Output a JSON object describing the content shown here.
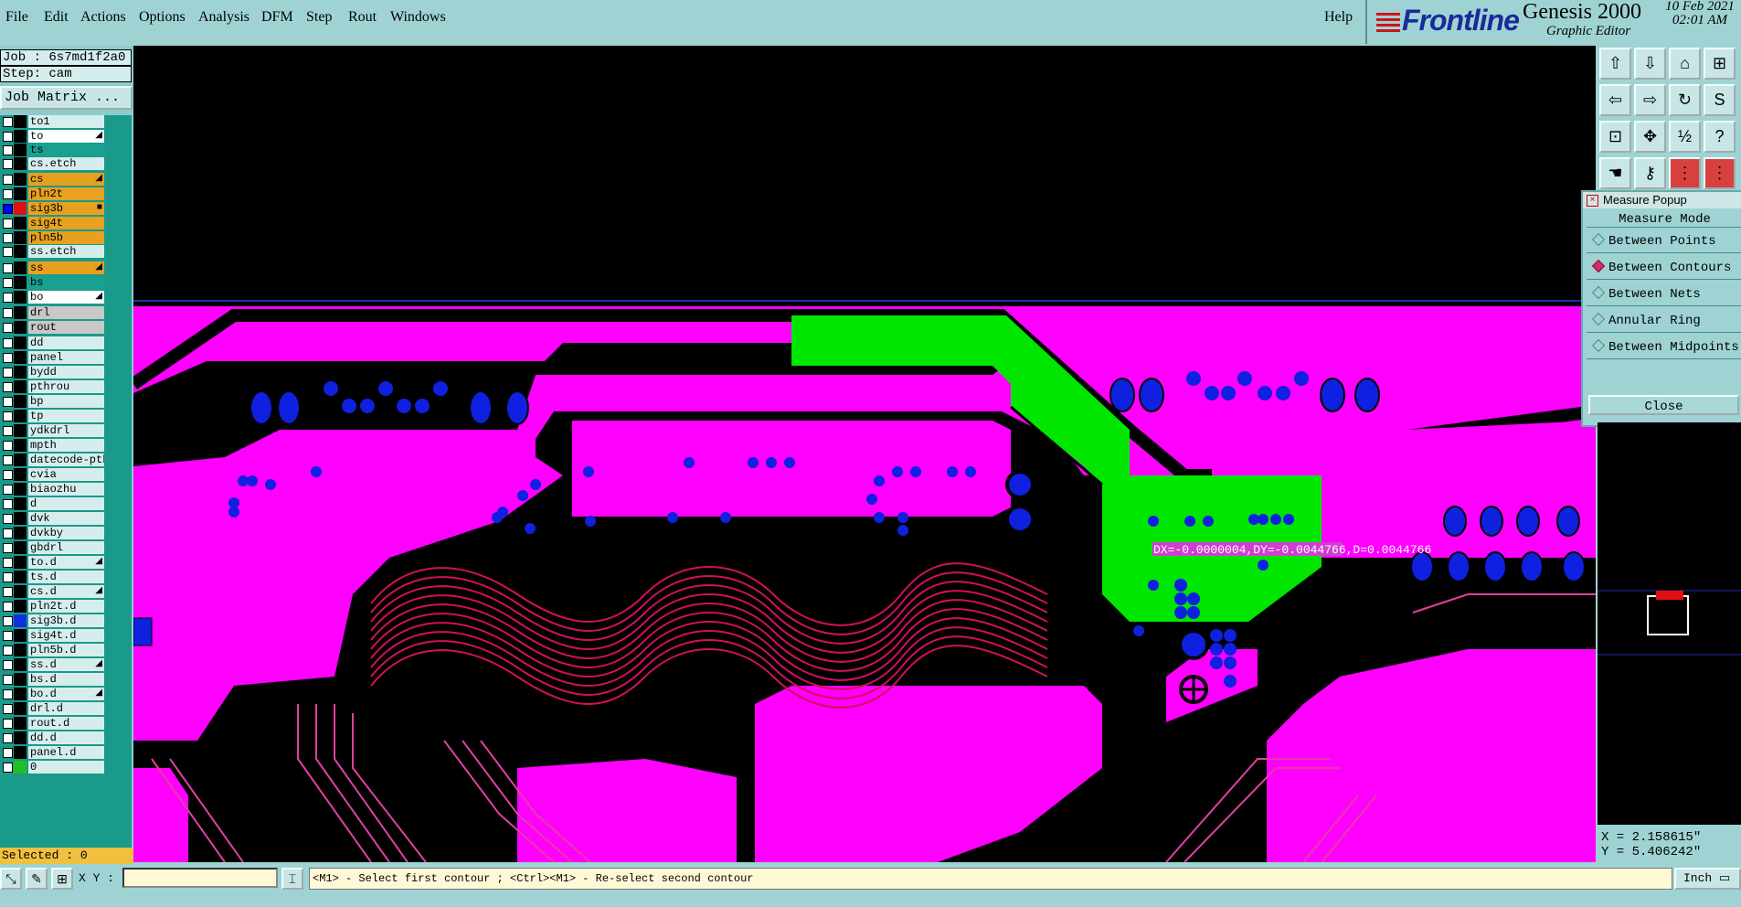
{
  "menu": {
    "items": [
      "File",
      "Edit",
      "Actions",
      "Options",
      "Analysis",
      "DFM",
      "Step",
      "Rout",
      "Windows"
    ],
    "help": "Help"
  },
  "brand": {
    "logo": "Frontline",
    "product": "Genesis 2000",
    "subtitle": "Graphic Editor",
    "date": "10 Feb 2021",
    "time": "02:01 AM"
  },
  "job": {
    "job_line": "Job : 6s7md1f2a0",
    "step_line": "Step: cam",
    "matrix_button": "Job Matrix ..."
  },
  "layers": [
    {
      "name": "to1",
      "bg": "#d6eded",
      "sw": "#000000"
    },
    {
      "name": "to",
      "bg": "#ffffff",
      "sw": "#000000",
      "mark": "◢"
    },
    {
      "name": "ts",
      "bg": "#1aa090",
      "sw": "#000000"
    },
    {
      "name": "cs.etch",
      "bg": "#d6eded",
      "sw": "#000000"
    },
    {
      "name": "cs",
      "bg": "#e8a020",
      "sw": "#000000",
      "mark": "◢"
    },
    {
      "name": "pln2t",
      "bg": "#e8a020",
      "sw": "#000000"
    },
    {
      "name": "sig3b",
      "bg": "#e8a020",
      "sw": "#e01010",
      "on": true,
      "mark": "■"
    },
    {
      "name": "sig4t",
      "bg": "#e8a020",
      "sw": "#000000"
    },
    {
      "name": "pln5b",
      "bg": "#e8a020",
      "sw": "#000000"
    },
    {
      "name": "ss.etch",
      "bg": "#d6eded",
      "sw": "#000000"
    },
    {
      "name": "ss",
      "bg": "#e8a020",
      "sw": "#000000",
      "mark": "◢"
    },
    {
      "name": "bs",
      "bg": "#1aa090",
      "sw": "#000000"
    },
    {
      "name": "bo",
      "bg": "#ffffff",
      "sw": "#000000",
      "mark": "◢"
    },
    {
      "name": "drl",
      "bg": "#c8c8c8",
      "sw": "#000000"
    },
    {
      "name": "rout",
      "bg": "#c8c8c8",
      "sw": "#000000"
    },
    {
      "name": "dd",
      "bg": "#d6eded",
      "sw": "#000000"
    },
    {
      "name": "panel",
      "bg": "#d6eded",
      "sw": "#000000"
    },
    {
      "name": "bydd",
      "bg": "#d6eded",
      "sw": "#000000"
    },
    {
      "name": "pthrou",
      "bg": "#d6eded",
      "sw": "#000000"
    },
    {
      "name": "bp",
      "bg": "#d6eded",
      "sw": "#000000"
    },
    {
      "name": "tp",
      "bg": "#d6eded",
      "sw": "#000000"
    },
    {
      "name": "ydkdrl",
      "bg": "#d6eded",
      "sw": "#000000"
    },
    {
      "name": "mpth",
      "bg": "#d6eded",
      "sw": "#000000"
    },
    {
      "name": "datecode-pth",
      "bg": "#d6eded",
      "sw": "#000000"
    },
    {
      "name": "cvia",
      "bg": "#d6eded",
      "sw": "#000000"
    },
    {
      "name": "biaozhu",
      "bg": "#d6eded",
      "sw": "#000000"
    },
    {
      "name": "d",
      "bg": "#d6eded",
      "sw": "#000000"
    },
    {
      "name": "dvk",
      "bg": "#d6eded",
      "sw": "#000000"
    },
    {
      "name": "dvkby",
      "bg": "#d6eded",
      "sw": "#000000"
    },
    {
      "name": "gbdrl",
      "bg": "#d6eded",
      "sw": "#000000"
    },
    {
      "name": "to.d",
      "bg": "#d6eded",
      "sw": "#000000",
      "mark": "◢"
    },
    {
      "name": "ts.d",
      "bg": "#d6eded",
      "sw": "#000000"
    },
    {
      "name": "cs.d",
      "bg": "#d6eded",
      "sw": "#000000",
      "mark": "◢"
    },
    {
      "name": "pln2t.d",
      "bg": "#d6eded",
      "sw": "#000000"
    },
    {
      "name": "sig3b.d",
      "bg": "#d6eded",
      "sw": "#1030e0"
    },
    {
      "name": "sig4t.d",
      "bg": "#d6eded",
      "sw": "#000000"
    },
    {
      "name": "pln5b.d",
      "bg": "#d6eded",
      "sw": "#000000"
    },
    {
      "name": "ss.d",
      "bg": "#d6eded",
      "sw": "#000000",
      "mark": "◢"
    },
    {
      "name": "bs.d",
      "bg": "#d6eded",
      "sw": "#000000"
    },
    {
      "name": "bo.d",
      "bg": "#d6eded",
      "sw": "#000000",
      "mark": "◢"
    },
    {
      "name": "drl.d",
      "bg": "#d6eded",
      "sw": "#000000"
    },
    {
      "name": "rout.d",
      "bg": "#d6eded",
      "sw": "#000000"
    },
    {
      "name": "dd.d",
      "bg": "#d6eded",
      "sw": "#000000"
    },
    {
      "name": "panel.d",
      "bg": "#d6eded",
      "sw": "#000000"
    },
    {
      "name": "0",
      "bg": "#d6eded",
      "sw": "#20c020"
    }
  ],
  "selected": "Selected : 0",
  "measure_popup": {
    "title": "Measure Popup",
    "mode_label": "Measure Mode",
    "options": [
      {
        "label": "Between Points",
        "on": false
      },
      {
        "label": "Between Contours",
        "on": true
      },
      {
        "label": "Between Nets",
        "on": false
      },
      {
        "label": "Annular Ring",
        "on": false
      },
      {
        "label": "Between Midpoints",
        "on": false
      }
    ],
    "close": "Close"
  },
  "measurement": {
    "text": "DX=-0.0000004,DY=-0.0044766,D=0.0044766"
  },
  "coords": {
    "x": "X = 2.158615\"",
    "y": "Y = 5.406242\""
  },
  "status": {
    "xy_label": "X Y :",
    "xy_value": "",
    "prompt": "<M1> - Select first contour ; <Ctrl><M1> - Re-select second contour",
    "unit": "Inch"
  },
  "colors": {
    "copper": "#ff00ff",
    "selected_copper": "#00e600",
    "via": "#1020e0",
    "trace": "#d0105a",
    "background": "#000000",
    "ui": "#9fd3d3"
  }
}
